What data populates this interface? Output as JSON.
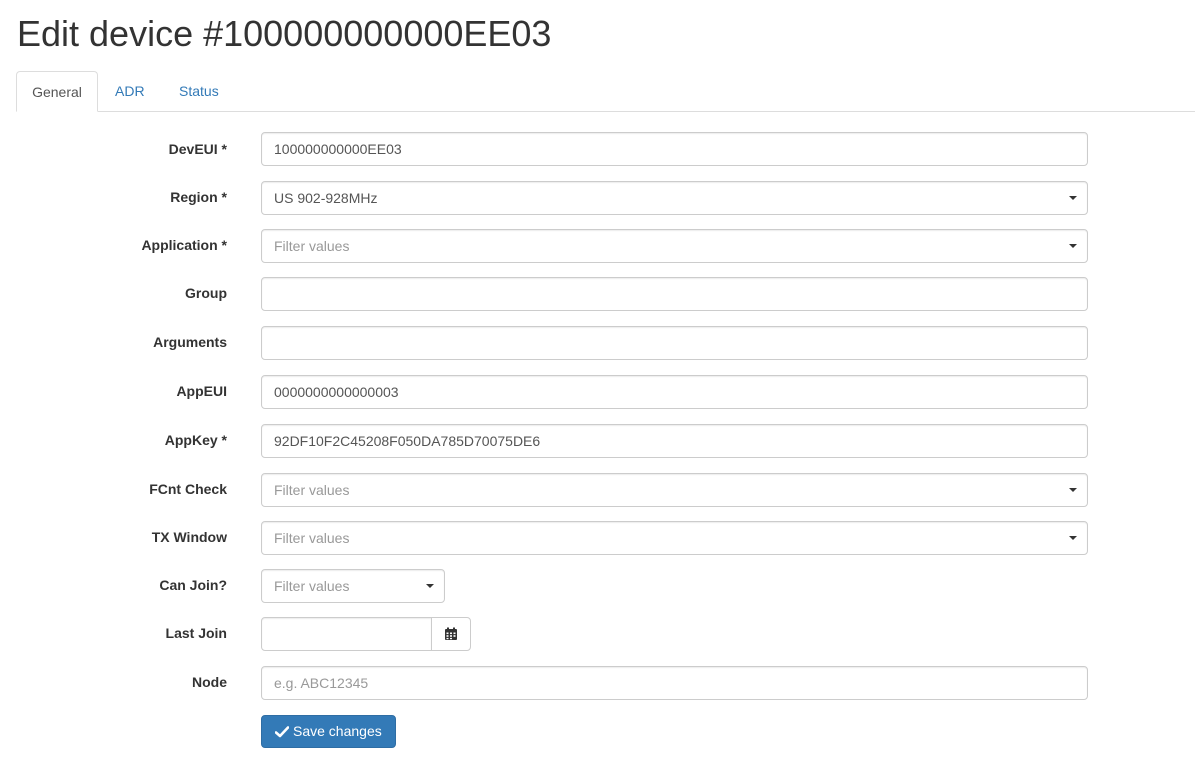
{
  "page": {
    "title": "Edit device #100000000000EE03"
  },
  "tabs": [
    {
      "label": "General",
      "active": true
    },
    {
      "label": "ADR",
      "active": false
    },
    {
      "label": "Status",
      "active": false
    }
  ],
  "form": {
    "deveui": {
      "label": "DevEUI *",
      "value": "100000000000EE03"
    },
    "region": {
      "label": "Region *",
      "value": "US 902-928MHz"
    },
    "application": {
      "label": "Application *",
      "placeholder": "Filter values"
    },
    "group": {
      "label": "Group",
      "value": ""
    },
    "arguments": {
      "label": "Arguments",
      "value": ""
    },
    "appeui": {
      "label": "AppEUI",
      "value": "0000000000000003"
    },
    "appkey": {
      "label": "AppKey *",
      "value": "92DF10F2C45208F050DA785D70075DE6"
    },
    "fcnt_check": {
      "label": "FCnt Check",
      "placeholder": "Filter values"
    },
    "tx_window": {
      "label": "TX Window",
      "placeholder": "Filter values"
    },
    "can_join": {
      "label": "Can Join?",
      "placeholder": "Filter values"
    },
    "last_join": {
      "label": "Last Join",
      "value": ""
    },
    "node": {
      "label": "Node",
      "placeholder": "e.g. ABC12345"
    }
  },
  "actions": {
    "save_label": "Save changes"
  },
  "icons": {
    "calendar": "calendar-icon",
    "check": "check-icon"
  },
  "colors": {
    "primary": "#337ab7",
    "link": "#337ab7",
    "border": "#cccccc"
  }
}
